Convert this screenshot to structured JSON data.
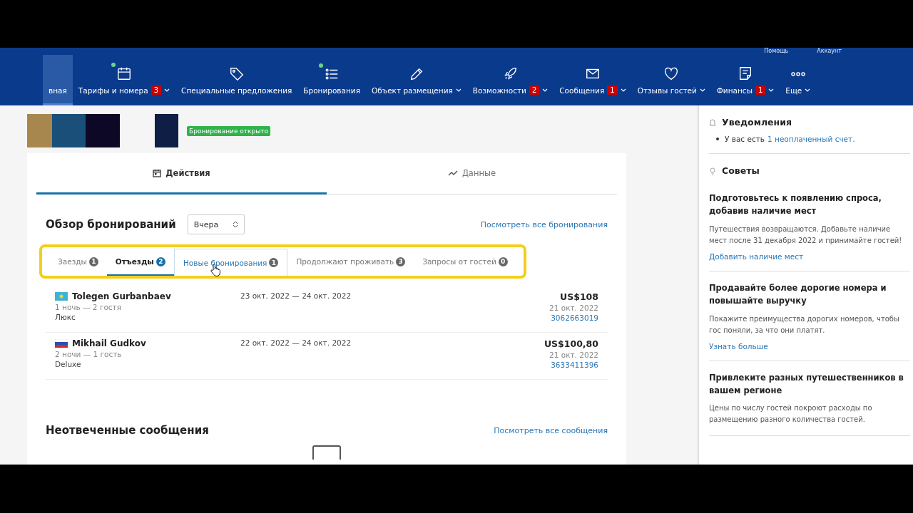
{
  "top_links": [
    "Помощь",
    "Аккаунт"
  ],
  "nav": [
    {
      "label": "вная",
      "selected": true,
      "dot": false,
      "dropdown": false
    },
    {
      "label": "Тарифы и номера",
      "badge": "3",
      "selected": false,
      "dot": true,
      "dropdown": true
    },
    {
      "label": "Специальные предложения",
      "selected": false,
      "dot": false,
      "dropdown": false
    },
    {
      "label": "Бронирования",
      "selected": false,
      "dot": true,
      "dropdown": false
    },
    {
      "label": "Объект размещения",
      "selected": false,
      "dot": false,
      "dropdown": true
    },
    {
      "label": "Возможности",
      "badge": "2",
      "selected": false,
      "dot": false,
      "dropdown": true
    },
    {
      "label": "Сообщения",
      "badge": "1",
      "selected": false,
      "dot": false,
      "dropdown": true
    },
    {
      "label": "Отзывы гостей",
      "selected": false,
      "dot": false,
      "dropdown": true
    },
    {
      "label": "Финансы",
      "badge": "1",
      "selected": false,
      "dot": false,
      "dropdown": true
    },
    {
      "label": "Еще",
      "selected": false,
      "dot": false,
      "dropdown": true
    }
  ],
  "property": {
    "status": "Бронирование открыто"
  },
  "main_tabs": [
    {
      "label": "Действия",
      "selected": true
    },
    {
      "label": "Данные",
      "selected": false
    }
  ],
  "overview": {
    "title": "Обзор бронирований",
    "period": "Вчера",
    "view_all": "Посмотреть все бронирования",
    "tabs": [
      {
        "label": "Заезды",
        "count": "1",
        "selected": false,
        "hovered": false
      },
      {
        "label": "Отъезды",
        "count": "2",
        "selected": true,
        "hovered": false
      },
      {
        "label": "Новые бронирования",
        "count": "1",
        "selected": false,
        "hovered": true
      },
      {
        "label": "Продолжают проживать",
        "count": "3",
        "selected": false,
        "hovered": false
      },
      {
        "label": "Запросы от гостей",
        "count": "0",
        "selected": false,
        "hovered": false
      }
    ],
    "bookings": [
      {
        "guest": "Tolegen Gurbanbaev",
        "details": "1 ночь — 2 гостя",
        "room": "Люкс",
        "dates": "23 окт. 2022 — 24 окт. 2022",
        "price": "US$108",
        "booked": "21 окт. 2022",
        "number": "3062663019"
      },
      {
        "guest": "Mikhail Gudkov",
        "details": "2 ночи — 1 гость",
        "room": "Deluxe",
        "dates": "22 окт. 2022 — 24 окт. 2022",
        "price": "US$100,80",
        "booked": "21 окт. 2022",
        "number": "3633411396"
      }
    ]
  },
  "messages": {
    "title": "Неотвеченные сообщения",
    "view_all": "Посмотреть все сообщения"
  },
  "notifications": {
    "title": "Уведомления",
    "items": [
      {
        "text": "У вас есть",
        "link": "1 неоплаченный счет."
      }
    ]
  },
  "tips": {
    "title": "Советы",
    "items": [
      {
        "title": "Подготовьтесь к появлению спроса, добавив наличие мест",
        "text": "Путешествия возвращаются. Добавьте наличие мест после 31 декабря 2022 и принимайте гостей!",
        "link": "Добавить наличие мест"
      },
      {
        "title": "Продавайте более дорогие номера и повышайте выручку",
        "text": "Покажите преимущества дорогих номеров, чтобы гос поняли, за что они платят.",
        "link": "Узнать больше"
      },
      {
        "title": "Привлеките разных путешественников в вашем регионе",
        "text": "Цены по числу гостей покроют расходы по размещению разного количества гостей."
      }
    ]
  }
}
